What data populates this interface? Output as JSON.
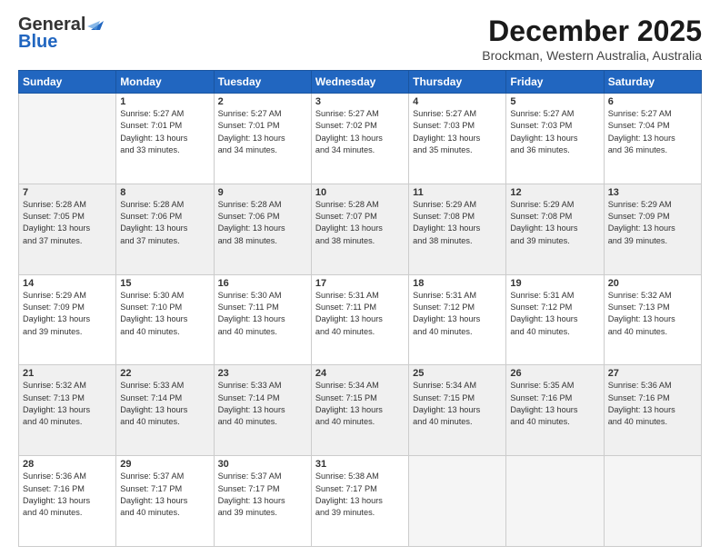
{
  "logo": {
    "line1": "General",
    "line2": "Blue"
  },
  "title": "December 2025",
  "location": "Brockman, Western Australia, Australia",
  "days_of_week": [
    "Sunday",
    "Monday",
    "Tuesday",
    "Wednesday",
    "Thursday",
    "Friday",
    "Saturday"
  ],
  "weeks": [
    [
      {
        "day": "",
        "info": ""
      },
      {
        "day": "1",
        "info": "Sunrise: 5:27 AM\nSunset: 7:01 PM\nDaylight: 13 hours\nand 33 minutes."
      },
      {
        "day": "2",
        "info": "Sunrise: 5:27 AM\nSunset: 7:01 PM\nDaylight: 13 hours\nand 34 minutes."
      },
      {
        "day": "3",
        "info": "Sunrise: 5:27 AM\nSunset: 7:02 PM\nDaylight: 13 hours\nand 34 minutes."
      },
      {
        "day": "4",
        "info": "Sunrise: 5:27 AM\nSunset: 7:03 PM\nDaylight: 13 hours\nand 35 minutes."
      },
      {
        "day": "5",
        "info": "Sunrise: 5:27 AM\nSunset: 7:03 PM\nDaylight: 13 hours\nand 36 minutes."
      },
      {
        "day": "6",
        "info": "Sunrise: 5:27 AM\nSunset: 7:04 PM\nDaylight: 13 hours\nand 36 minutes."
      }
    ],
    [
      {
        "day": "7",
        "info": "Sunrise: 5:28 AM\nSunset: 7:05 PM\nDaylight: 13 hours\nand 37 minutes."
      },
      {
        "day": "8",
        "info": "Sunrise: 5:28 AM\nSunset: 7:06 PM\nDaylight: 13 hours\nand 37 minutes."
      },
      {
        "day": "9",
        "info": "Sunrise: 5:28 AM\nSunset: 7:06 PM\nDaylight: 13 hours\nand 38 minutes."
      },
      {
        "day": "10",
        "info": "Sunrise: 5:28 AM\nSunset: 7:07 PM\nDaylight: 13 hours\nand 38 minutes."
      },
      {
        "day": "11",
        "info": "Sunrise: 5:29 AM\nSunset: 7:08 PM\nDaylight: 13 hours\nand 38 minutes."
      },
      {
        "day": "12",
        "info": "Sunrise: 5:29 AM\nSunset: 7:08 PM\nDaylight: 13 hours\nand 39 minutes."
      },
      {
        "day": "13",
        "info": "Sunrise: 5:29 AM\nSunset: 7:09 PM\nDaylight: 13 hours\nand 39 minutes."
      }
    ],
    [
      {
        "day": "14",
        "info": "Sunrise: 5:29 AM\nSunset: 7:09 PM\nDaylight: 13 hours\nand 39 minutes."
      },
      {
        "day": "15",
        "info": "Sunrise: 5:30 AM\nSunset: 7:10 PM\nDaylight: 13 hours\nand 40 minutes."
      },
      {
        "day": "16",
        "info": "Sunrise: 5:30 AM\nSunset: 7:11 PM\nDaylight: 13 hours\nand 40 minutes."
      },
      {
        "day": "17",
        "info": "Sunrise: 5:31 AM\nSunset: 7:11 PM\nDaylight: 13 hours\nand 40 minutes."
      },
      {
        "day": "18",
        "info": "Sunrise: 5:31 AM\nSunset: 7:12 PM\nDaylight: 13 hours\nand 40 minutes."
      },
      {
        "day": "19",
        "info": "Sunrise: 5:31 AM\nSunset: 7:12 PM\nDaylight: 13 hours\nand 40 minutes."
      },
      {
        "day": "20",
        "info": "Sunrise: 5:32 AM\nSunset: 7:13 PM\nDaylight: 13 hours\nand 40 minutes."
      }
    ],
    [
      {
        "day": "21",
        "info": "Sunrise: 5:32 AM\nSunset: 7:13 PM\nDaylight: 13 hours\nand 40 minutes."
      },
      {
        "day": "22",
        "info": "Sunrise: 5:33 AM\nSunset: 7:14 PM\nDaylight: 13 hours\nand 40 minutes."
      },
      {
        "day": "23",
        "info": "Sunrise: 5:33 AM\nSunset: 7:14 PM\nDaylight: 13 hours\nand 40 minutes."
      },
      {
        "day": "24",
        "info": "Sunrise: 5:34 AM\nSunset: 7:15 PM\nDaylight: 13 hours\nand 40 minutes."
      },
      {
        "day": "25",
        "info": "Sunrise: 5:34 AM\nSunset: 7:15 PM\nDaylight: 13 hours\nand 40 minutes."
      },
      {
        "day": "26",
        "info": "Sunrise: 5:35 AM\nSunset: 7:16 PM\nDaylight: 13 hours\nand 40 minutes."
      },
      {
        "day": "27",
        "info": "Sunrise: 5:36 AM\nSunset: 7:16 PM\nDaylight: 13 hours\nand 40 minutes."
      }
    ],
    [
      {
        "day": "28",
        "info": "Sunrise: 5:36 AM\nSunset: 7:16 PM\nDaylight: 13 hours\nand 40 minutes."
      },
      {
        "day": "29",
        "info": "Sunrise: 5:37 AM\nSunset: 7:17 PM\nDaylight: 13 hours\nand 40 minutes."
      },
      {
        "day": "30",
        "info": "Sunrise: 5:37 AM\nSunset: 7:17 PM\nDaylight: 13 hours\nand 39 minutes."
      },
      {
        "day": "31",
        "info": "Sunrise: 5:38 AM\nSunset: 7:17 PM\nDaylight: 13 hours\nand 39 minutes."
      },
      {
        "day": "",
        "info": ""
      },
      {
        "day": "",
        "info": ""
      },
      {
        "day": "",
        "info": ""
      }
    ]
  ]
}
